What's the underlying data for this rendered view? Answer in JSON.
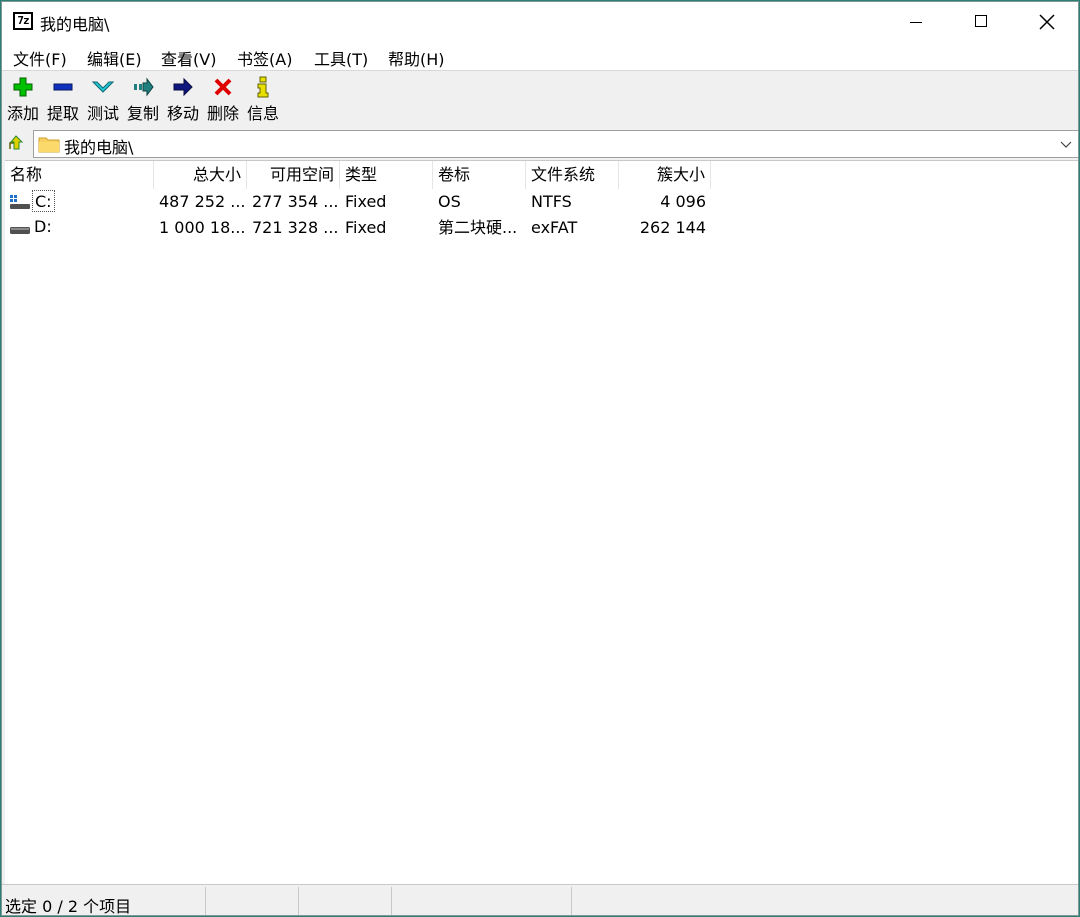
{
  "window": {
    "title": "我的电脑\\",
    "app_icon_text": "7z"
  },
  "menu": [
    "文件(F)",
    "编辑(E)",
    "查看(V)",
    "书签(A)",
    "工具(T)",
    "帮助(H)"
  ],
  "toolbar": [
    {
      "label": "添加",
      "icon": "plus-icon",
      "color": "#00c000"
    },
    {
      "label": "提取",
      "icon": "minus-icon",
      "color": "#1030c0"
    },
    {
      "label": "测试",
      "icon": "check-chevron-icon",
      "color": "#20b8c8"
    },
    {
      "label": "复制",
      "icon": "copy-arrow-icon",
      "color": "#208080"
    },
    {
      "label": "移动",
      "icon": "move-arrow-icon",
      "color": "#101880"
    },
    {
      "label": "删除",
      "icon": "x-icon",
      "color": "#e00000"
    },
    {
      "label": "信息",
      "icon": "info-icon",
      "color": "#e8e000"
    }
  ],
  "address": {
    "path": "我的电脑\\"
  },
  "columns": [
    "名称",
    "总大小",
    "可用空间",
    "类型",
    "卷标",
    "文件系统",
    "簇大小"
  ],
  "drives": [
    {
      "name": "C:",
      "total": "487 252 ...",
      "free": "277 354 ...",
      "type": "Fixed",
      "label": "OS",
      "fs": "NTFS",
      "cluster": "4 096",
      "icon": "windows-drive-icon"
    },
    {
      "name": "D:",
      "total": "1 000 18...",
      "free": "721 328 ...",
      "type": "Fixed",
      "label": "第二块硬...",
      "fs": "exFAT",
      "cluster": "262 144",
      "icon": "hard-drive-icon"
    }
  ],
  "status": {
    "selection": "选定 0 / 2 个项目"
  }
}
